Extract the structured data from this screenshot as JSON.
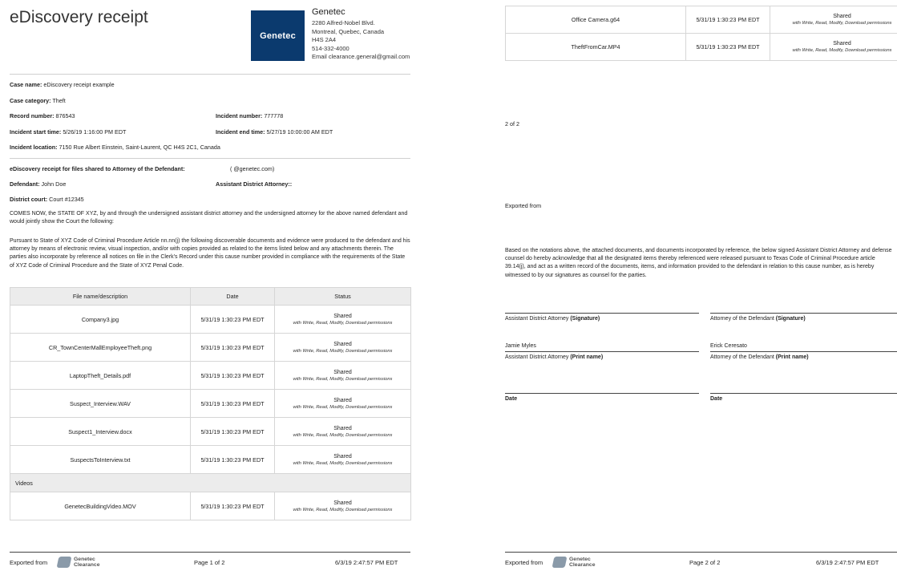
{
  "page1": {
    "title": "eDiscovery receipt",
    "logo_text": "Genetec",
    "company": {
      "name": "Genetec",
      "address1": "2280 Alfred-Nobel Blvd.",
      "address2": "Montreal, Quebec, Canada",
      "postal": "H4S 2A4",
      "phone": "514-332-4000",
      "email": "Email clearance.general@gmail.com"
    },
    "case": {
      "name_label": "Case name:",
      "name_value": "eDiscovery receipt example",
      "category_label": "Case category:",
      "category_value": "Theft",
      "record_label": "Record number:",
      "record_value": "876543",
      "incident_num_label": "Incident number:",
      "incident_num_value": "777778",
      "start_label": "Incident start time:",
      "start_value": "5/26/19 1:16:00 PM EDT",
      "end_label": "Incident end time:",
      "end_value": "5/27/19 10:00:00 AM EDT",
      "location_label": "Incident location:",
      "location_value": "7150 Rue Albert Einstein, Saint-Laurent, QC H4S 2C1, Canada"
    },
    "receipt": {
      "shared_label": "eDiscovery receipt for files shared to Attorney of the Defendant:",
      "shared_value": "(          @genetec.com)",
      "defendant_label": "Defendant:",
      "defendant_value": "John Doe",
      "ada_label": "Assistant District Attorney::",
      "court_label": "District court:",
      "court_value": "Court #12345"
    },
    "para1": "COMES NOW, the STATE OF XYZ, by and through the undersigned assistant district attorney and the undersigned attorney for the above named defendant and would jointly show the Court the following:",
    "para2": "Pursuant to State of XYZ Code of Criminal Procedure Article nn.nn(j) the following discoverable documents and evidence were produced to the defendant and his attorney by means of electronic review, visual inspection, and/or with copies provided as related to the items listed below and any attachments therein.  The parties also incorporate by reference all notices on file in the Clerk's Record under this cause number provided in compliance with the requirements of the State of XYZ Code of Criminal Procedure and the State of XYZ Penal Code.",
    "table_headers": [
      "File name/description",
      "Date",
      "Status"
    ],
    "files": [
      {
        "name": "Company3.jpg",
        "date": "5/31/19 1:30:23 PM EDT",
        "status": "Shared",
        "perm": "with Write, Read, Modify, Download permissions"
      },
      {
        "name": "CR_TownCenterMallEmployeeTheft.png",
        "date": "5/31/19 1:30:23 PM EDT",
        "status": "Shared",
        "perm": "with Write, Read, Modify, Download permissions"
      },
      {
        "name": "LaptopTheft_Details.pdf",
        "date": "5/31/19 1:30:23 PM EDT",
        "status": "Shared",
        "perm": "with Write, Read, Modify, Download permissions"
      },
      {
        "name": "Suspect_Interview.WAV",
        "date": "5/31/19 1:30:23 PM EDT",
        "status": "Shared",
        "perm": "with Write, Read, Modify, Download permissions"
      },
      {
        "name": "Suspect1_Interview.docx",
        "date": "5/31/19 1:30:23 PM EDT",
        "status": "Shared",
        "perm": "with Write, Read, Modify, Download permissions"
      },
      {
        "name": "SuspectsToInterview.txt",
        "date": "5/31/19 1:30:23 PM EDT",
        "status": "Shared",
        "perm": "with Write, Read, Modify, Download permissions"
      }
    ],
    "videos_group": "Videos",
    "videos": [
      {
        "name": "GenetecBuildingVideo.MOV",
        "date": "5/31/19 1:30:23 PM EDT",
        "status": "Shared",
        "perm": "with Write, Read, Modify, Download permissions"
      }
    ],
    "footer": {
      "exported_from": "Exported from",
      "brand_line1": "Genetec",
      "brand_line2": "Clearance",
      "page": "Page 1 of 2",
      "timestamp": "6/3/19 2:47:57 PM EDT"
    }
  },
  "page2": {
    "files": [
      {
        "name": "Office Camera.g64",
        "date": "5/31/19 1:30:23 PM EDT",
        "status": "Shared",
        "perm": "with Write, Read, Modify, Download permissions"
      },
      {
        "name": "TheftFromCar.MP4",
        "date": "5/31/19 1:30:23 PM EDT",
        "status": "Shared",
        "perm": "with Write, Read, Modify, Download permissions"
      }
    ],
    "page_count": "2 of 2",
    "exported_from_text": "Exported from",
    "notice": "Based on the notations above, the attached documents, and documents incorporated by reference, the below signed Assistant District Attorney and defense counsel do hereby acknowledge that all the designated items thereby referenced were released pursuant to Texas Code of Criminal Procedure article 39.14(j), and act as a written record of the documents, items, and information provided to the defendant in relation to this cause number, as is hereby witnessed to by our signatures as counsel for the parties.",
    "sig": {
      "ada_sig_prefix": "Assistant District Attorney",
      "ada_sig_bold": "(Signature)",
      "def_sig_prefix": "Attorney of the Defendant",
      "def_sig_bold": "(Signature)",
      "ada_name": "Jamie Myles",
      "def_name": "Erick Ceresato",
      "ada_print_prefix": "Assistant District Attorney",
      "ada_print_bold": "(Print name)",
      "def_print_prefix": "Attorney of the Defendant",
      "def_print_bold": "(Print name)",
      "date_left": "Date",
      "date_right": "Date"
    },
    "footer": {
      "exported_from": "Exported from",
      "brand_line1": "Genetec",
      "brand_line2": "Clearance",
      "page": "Page 2 of 2",
      "timestamp": "6/3/19 2:47:57 PM EDT"
    }
  }
}
